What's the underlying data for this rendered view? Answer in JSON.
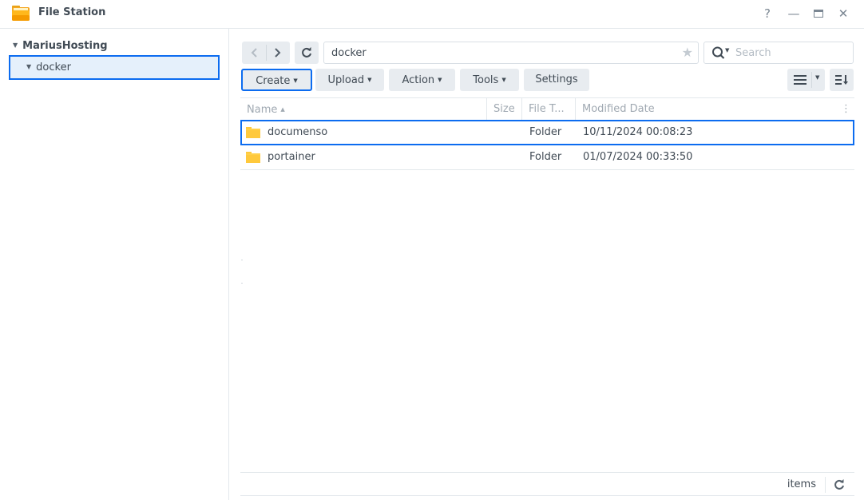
{
  "window": {
    "title": "File Station",
    "controls": {
      "help": "?",
      "minimize": "—",
      "maximize": "▭",
      "close": "✕"
    }
  },
  "sidebar": {
    "root": {
      "label": "MariusHosting",
      "expanded": true
    },
    "children": [
      {
        "label": "docker",
        "expanded": true,
        "selected": true
      }
    ]
  },
  "toolbar": {
    "back": "‹",
    "forward": "›",
    "refresh": "↻",
    "path": "docker",
    "search_placeholder": "Search",
    "buttons": [
      {
        "label": "Create",
        "has_menu": true,
        "focused": true
      },
      {
        "label": "Upload",
        "has_menu": true
      },
      {
        "label": "Action",
        "has_menu": true
      },
      {
        "label": "Tools",
        "has_menu": true
      },
      {
        "label": "Settings",
        "has_menu": false
      }
    ]
  },
  "table": {
    "columns": [
      {
        "label": "Name",
        "sorted": "asc"
      },
      {
        "label": "Size"
      },
      {
        "label": "File T..."
      },
      {
        "label": "Modified Date"
      }
    ],
    "more": "⋮",
    "rows": [
      {
        "name": "documenso",
        "size": "",
        "type": "Folder",
        "modified": "10/11/2024 00:08:23",
        "selected": true
      },
      {
        "name": "portainer",
        "size": "",
        "type": "Folder",
        "modified": "01/07/2024 00:33:50",
        "selected": false
      }
    ]
  },
  "statusbar": {
    "items_label": "items",
    "refresh": "↻"
  },
  "colors": {
    "accent": "#0c6cf0",
    "selection_bg": "#e5f0fb",
    "folder": "#ffc93c",
    "button_bg": "#e8ecf0"
  }
}
